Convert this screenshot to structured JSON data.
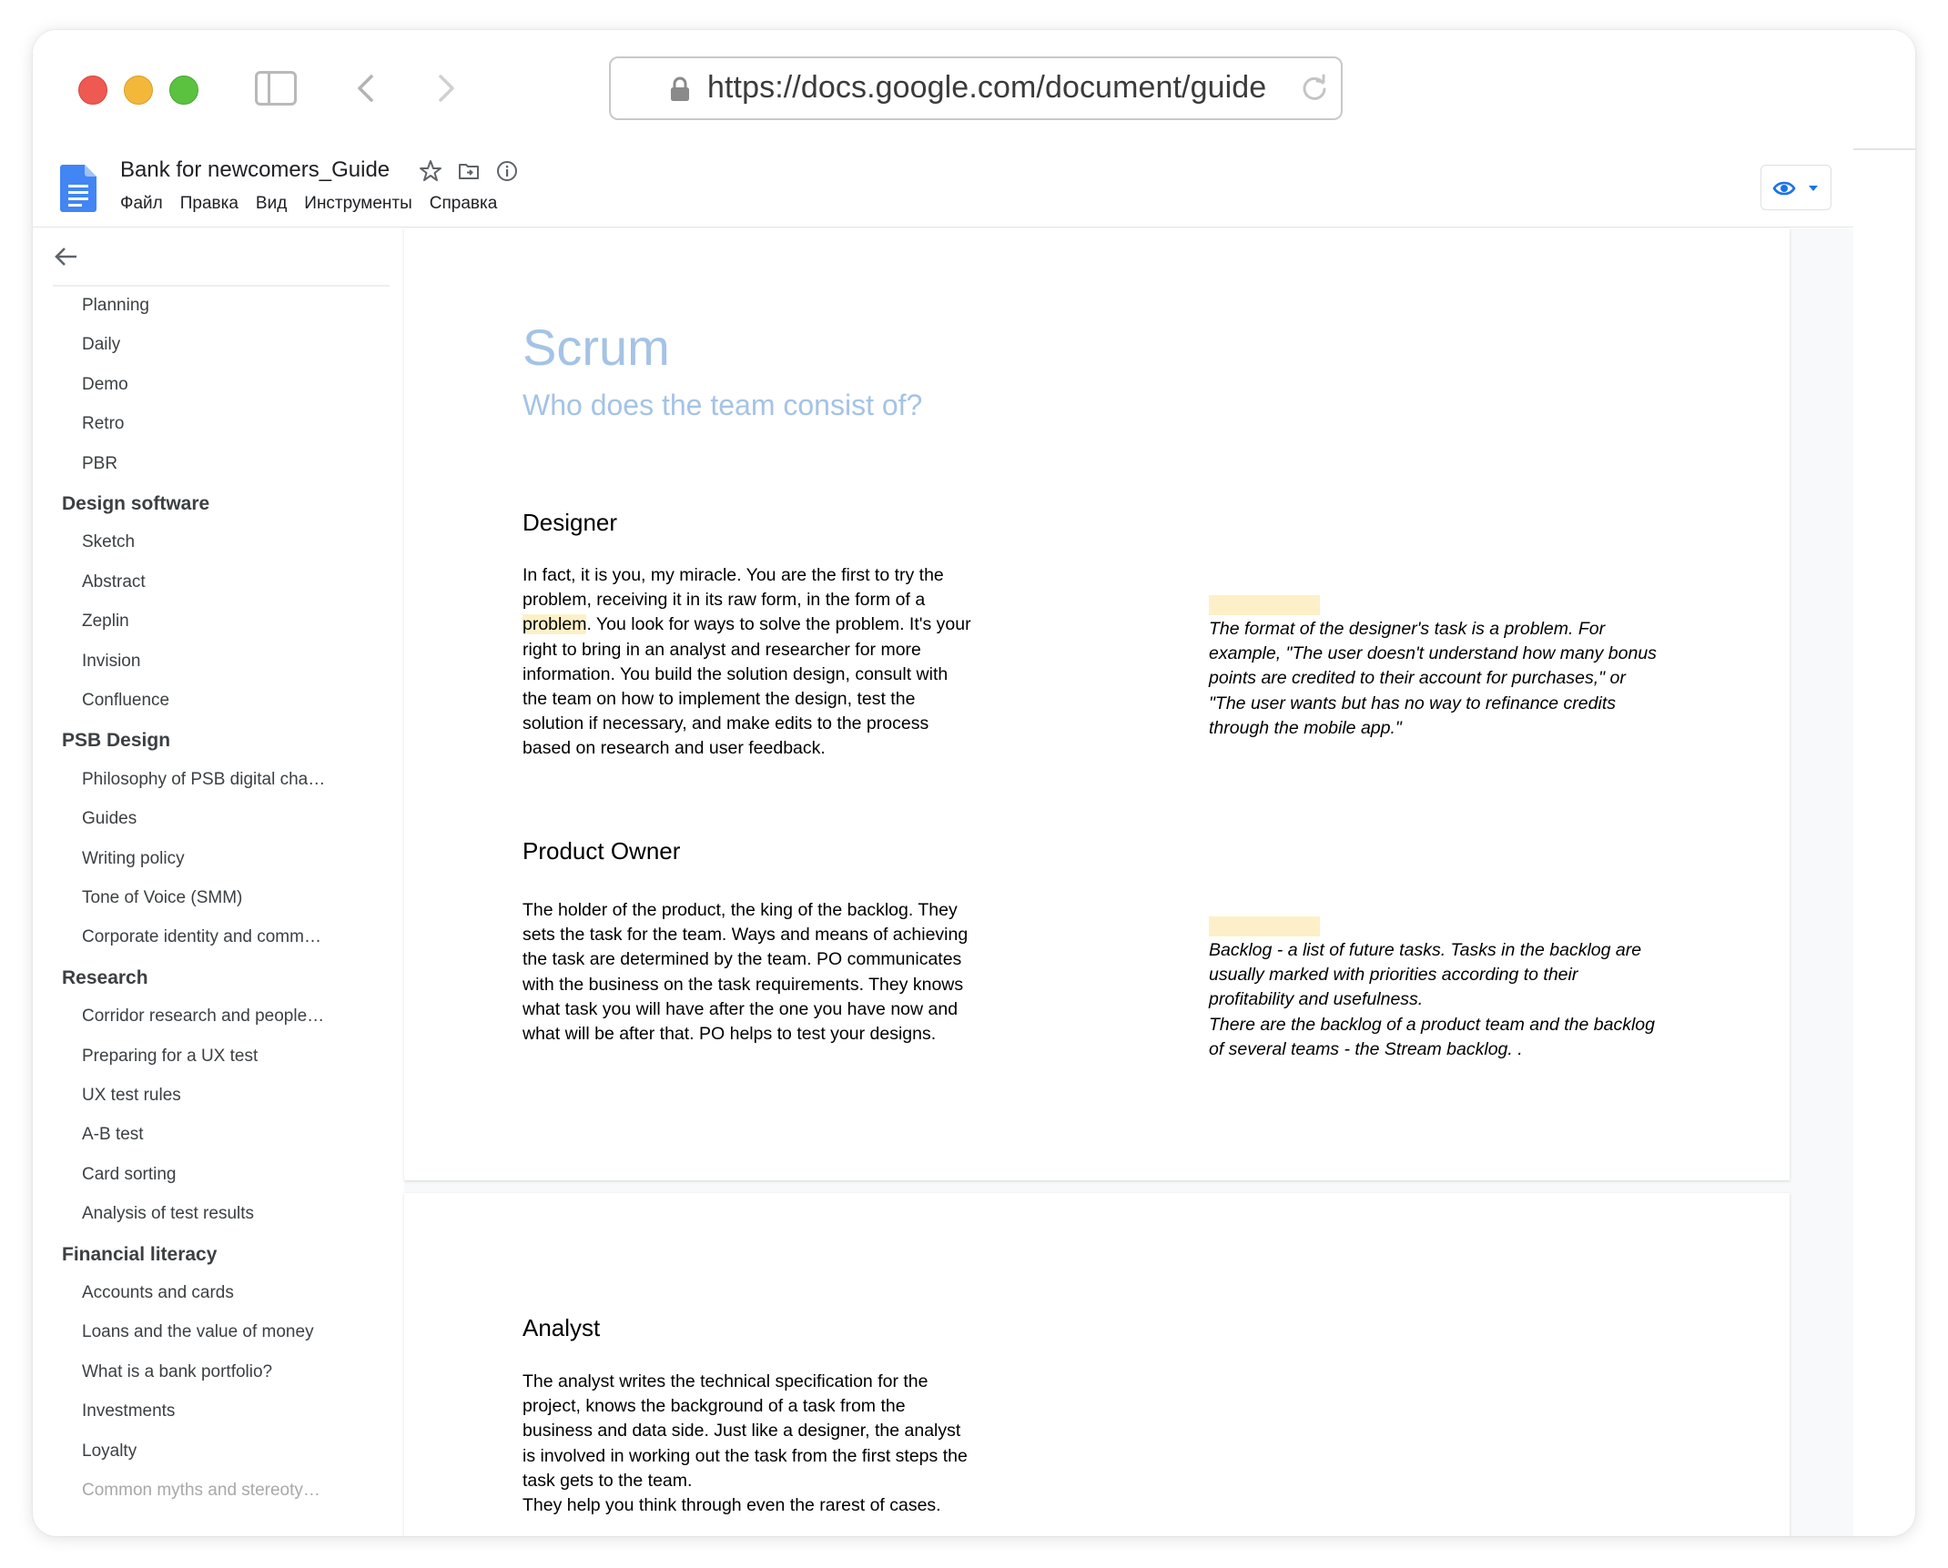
{
  "browser": {
    "url": "https://docs.google.com/document/guide"
  },
  "docs": {
    "title": "Bank for newcomers_Guide",
    "menu": [
      "Файл",
      "Правка",
      "Вид",
      "Инструменты",
      "Справка"
    ]
  },
  "outline": {
    "items": [
      {
        "label": "Planning",
        "level": 2
      },
      {
        "label": "Daily",
        "level": 2
      },
      {
        "label": "Demo",
        "level": 2
      },
      {
        "label": "Retro",
        "level": 2
      },
      {
        "label": "PBR",
        "level": 2
      },
      {
        "label": "Design software",
        "level": 1
      },
      {
        "label": "Sketch",
        "level": 2
      },
      {
        "label": "Abstract",
        "level": 2
      },
      {
        "label": "Zeplin",
        "level": 2
      },
      {
        "label": "Invision",
        "level": 2
      },
      {
        "label": "Confluence",
        "level": 2
      },
      {
        "label": "PSB Design",
        "level": 1
      },
      {
        "label": "Philosophy of PSB digital cha…",
        "level": 2
      },
      {
        "label": "Guides",
        "level": 2
      },
      {
        "label": "Writing policy",
        "level": 2
      },
      {
        "label": "Tone of Voice (SMM)",
        "level": 2
      },
      {
        "label": "Corporate identity and comm…",
        "level": 2
      },
      {
        "label": "Research",
        "level": 1
      },
      {
        "label": "Corridor research and people…",
        "level": 2
      },
      {
        "label": "Preparing for a UX test",
        "level": 2
      },
      {
        "label": "UX test rules",
        "level": 2
      },
      {
        "label": "A-B test",
        "level": 2
      },
      {
        "label": "Card sorting",
        "level": 2
      },
      {
        "label": "Analysis of test results",
        "level": 2
      },
      {
        "label": "Financial literacy",
        "level": 1
      },
      {
        "label": "Accounts and cards",
        "level": 2
      },
      {
        "label": "Loans and the value of money",
        "level": 2
      },
      {
        "label": "What is a bank portfolio?",
        "level": 2
      },
      {
        "label": "Investments",
        "level": 2
      },
      {
        "label": "Loyalty",
        "level": 2
      },
      {
        "label": "Common myths and stereoty…",
        "level": 2,
        "faded": true
      }
    ]
  },
  "document": {
    "title": "Scrum",
    "subtitle": "Who does the team consist of?",
    "designer": {
      "heading": "Designer",
      "lines": [
        "In fact, it is you, my miracle. You are the first to try the",
        "problem, receiving it in its raw form, in the form of a",
        "problem",
        ". You look for ways to solve the problem. It's your",
        "right to bring in an analyst and researcher for more",
        "information. You build the solution design, consult with",
        "the team on how to implement the design, test the",
        "solution if necessary, and make edits to the process",
        "based on research and user feedback."
      ],
      "note_lines": [
        "The format of the designer's task is a problem. For",
        "example, \"The user doesn't understand how many bonus",
        "points are credited to their account for purchases,\" or",
        "\"The user wants but has no way to refinance credits",
        "through the mobile app.\""
      ]
    },
    "product_owner": {
      "heading": "Product Owner",
      "lines": [
        "The holder of the product, the king of the backlog. They",
        "sets the task for the team. Ways and means of achieving",
        "the task are determined by the team. PO communicates",
        "with the business on the task requirements. They knows",
        "what task you will have after the one you have now and",
        "what will be after that. PO helps to test your designs."
      ],
      "note_lines": [
        "Backlog - a list of future tasks. Tasks in the backlog are",
        "usually marked with priorities according to their",
        "profitability and usefulness.",
        "There are the backlog of a product team and the backlog",
        "of several teams - the Stream backlog. ."
      ]
    },
    "analyst": {
      "heading": "Analyst",
      "lines": [
        "The analyst writes the technical specification for the",
        "project, knows the background of a task from the",
        "business and data side. Just like a designer, the analyst",
        "is involved in working out the task from the first steps the",
        "task gets to the team.",
        "They help you think through even the rarest of cases."
      ]
    }
  }
}
